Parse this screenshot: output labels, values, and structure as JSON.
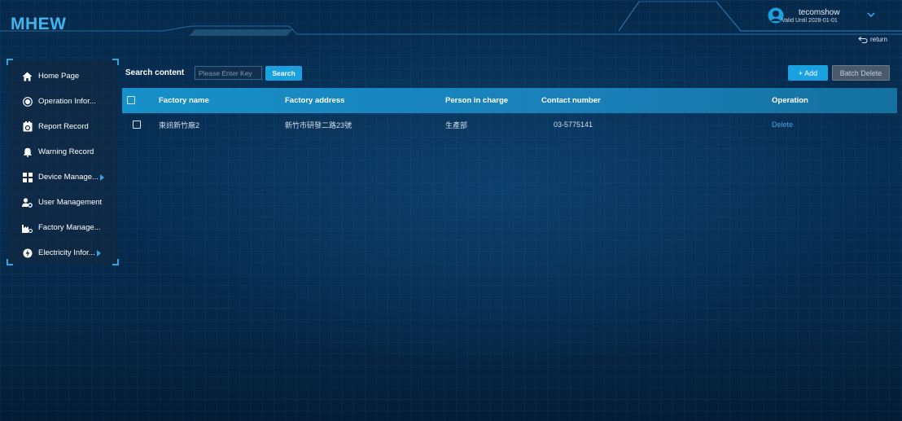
{
  "app": {
    "title": "MHEW"
  },
  "user": {
    "name": "tecomshow",
    "valid_text": "Valid Until 2028-01-01"
  },
  "header": {
    "return_label": "return"
  },
  "sidebar": {
    "items": [
      {
        "label": "Home Page",
        "icon": "home-icon",
        "has_submenu": false
      },
      {
        "label": "Operation Infor...",
        "icon": "radio-circle-icon",
        "has_submenu": false
      },
      {
        "label": "Report Record",
        "icon": "report-icon",
        "has_submenu": false
      },
      {
        "label": "Warning Record",
        "icon": "bell-icon",
        "has_submenu": false
      },
      {
        "label": "Device Manage...",
        "icon": "device-grid-icon",
        "has_submenu": true
      },
      {
        "label": "User Management",
        "icon": "user-gear-icon",
        "has_submenu": false
      },
      {
        "label": "Factory Manage...",
        "icon": "factory-icon",
        "has_submenu": false
      },
      {
        "label": "Electricity Infor...",
        "icon": "electricity-icon",
        "has_submenu": true
      }
    ]
  },
  "toolbar": {
    "search_label": "Search content",
    "search_placeholder": "Please Enter Key",
    "search_button": "Search",
    "add_button": "+ Add",
    "batch_delete_button": "Batch Delete"
  },
  "table": {
    "columns": [
      "Factory name",
      "Factory address",
      "Person in charge",
      "Contact number",
      "Operation"
    ],
    "rows": [
      {
        "factory_name": "東訊新竹廠2",
        "factory_address": "新竹市研發二路23號",
        "person_in_charge": "生產部",
        "contact_number": "03-5775141",
        "operation": "Delete"
      }
    ]
  },
  "colors": {
    "accent": "#1aa2e0",
    "logo": "#44b4ee",
    "background": "#062a4b",
    "table_header": "#1690c8",
    "link": "#3ba4e6"
  }
}
